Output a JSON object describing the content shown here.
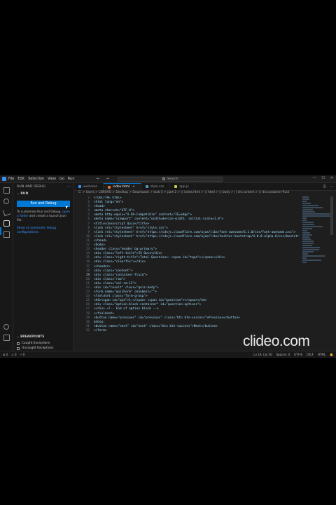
{
  "menu": [
    "File",
    "Edit",
    "Selection",
    "View",
    "Go",
    "Run"
  ],
  "search_placeholder": "Search",
  "window_controls": [
    "—",
    "☐",
    "✕"
  ],
  "sidebar": {
    "title": "RUN AND DEBUG",
    "section": "RUN",
    "run_button": "Run and Debug",
    "text1_pre": "To customize Run and Debug, ",
    "text1_link": "open a folder",
    "text1_post": " and create a launch.json file.",
    "text2_link": "Show all automatic debug configurations.",
    "breakpoints_header": "BREAKPOINTS",
    "bp_items": [
      "Caught Exceptions",
      "Uncaught Exceptions"
    ],
    "bp_footer": "BROWSER BREAKPOINTS"
  },
  "tabs": [
    {
      "label": "welcome",
      "icon_color": "#3794ff"
    },
    {
      "label": "index.html",
      "icon_color": "#e37933",
      "active": true
    },
    {
      "label": "style.css",
      "icon_color": "#519aba"
    },
    {
      "label": "app.js",
      "icon_color": "#cbcb41"
    }
  ],
  "breadcrumb": "C: > Users > LENOVO > Desktop > Downloads > task-3 > part-2 > ⟨⟩ index.html > ⟨⟩ html > ⟨⟩ body > ⟨⟩ div.content > ⟨⟩ div.container-fluid",
  "code_lines": [
    {
      "n": "1",
      "t": "<!DOCTYPE html>"
    },
    {
      "n": "2",
      "t": "<html lang=\"en\">"
    },
    {
      "n": "3",
      "t": "<head>"
    },
    {
      "n": "4",
      "t": "<meta charset=\"UTF-8\">"
    },
    {
      "n": "5",
      "t": "<meta http-equiv=\"X-UA-Compatible\" content=\"IE=edge\">"
    },
    {
      "n": "6",
      "t": "<meta name=\"viewport\" content=\"width=device-width, initial-scale=1.0\">"
    },
    {
      "n": "7",
      "t": "<title>Javascript Quiz</title>"
    },
    {
      "n": "8",
      "t": "<link rel=\"stylesheet\" href=\"style.css\">"
    },
    {
      "n": "9",
      "t": "<link rel=\"stylesheet\" href=\"https://cdnjs.cloudflare.com/ajax/libs/font-awesome/6.1.0/css/font-awesome.css\">"
    },
    {
      "n": "10",
      "t": "<link rel=\"stylesheet\" href=\"https://cdnjs.cloudflare.com/ajax/libs/twitter-bootstrap/4.0.0-alpha.6/css/bootstr"
    },
    {
      "n": "11",
      "t": "</head>"
    },
    {
      "n": "12",
      "t": "<body>"
    },
    {
      "n": "13",
      "t": "<header class=\"header bg-primary\">"
    },
    {
      "n": "14",
      "t": "<div class=\"left-title\">JS Quiz</div>"
    },
    {
      "n": "15",
      "t": "<div class=\"right-title\">Total Questions: <span id=\"tque\"></span></div>"
    },
    {
      "n": "16",
      "t": "<div class=\"clearfix\"></div>"
    },
    {
      "n": "17",
      "t": "</header>"
    },
    {
      "n": "18",
      "t": "<div class=\"content\">"
    },
    {
      "n": "19",
      "t": "<div class=\"container-fluid\">",
      "cur": true
    },
    {
      "n": "20",
      "t": "<div class=\"row\">"
    },
    {
      "n": "21",
      "t": "<div class=\"col-sm-12\">"
    },
    {
      "n": "22",
      "t": "<div id=\"result\" class=\"quiz-body\">"
    },
    {
      "n": "23",
      "t": "<form name=\"quizForm\" onSubmit=\"\">"
    },
    {
      "n": "24",
      "t": "<fieldset class=\"form-group\">"
    },
    {
      "n": "25",
      "t": "<h4><span id=\"qid\">1.</span> <span id=\"question\"></span></h4>"
    },
    {
      "n": "26",
      "t": "<div class=\"option-block-container\" id=\"question-options\">"
    },
    {
      "n": "27",
      "t": "</div> <!-- End of option block -->"
    },
    {
      "n": "28",
      "t": "</fieldset>"
    },
    {
      "n": "29",
      "t": "<button name=\"previous\" id=\"previous\" class=\"btn btn-success\">Previous</button>"
    },
    {
      "n": "30",
      "t": "&nbsp;"
    },
    {
      "n": "31",
      "t": "<button name=\"next\" id=\"next\" class=\"btn btn-success\">Next</button>"
    },
    {
      "n": "32",
      "t": "</form>"
    }
  ],
  "status_left": [
    "⊗ 0",
    "⚠ 0",
    "⚡ 0"
  ],
  "status_right": [
    "Ln 19, Col 30",
    "Spaces: 4",
    "UTF-8",
    "CRLF",
    "HTML",
    "🔔"
  ],
  "watermark": "clideo.com"
}
